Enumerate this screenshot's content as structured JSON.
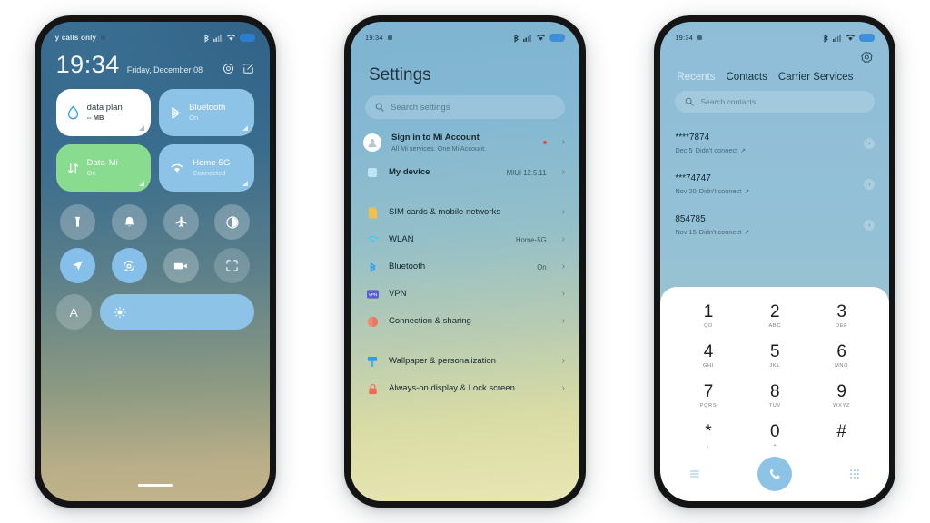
{
  "colors": {
    "accent_blue": "#8ec3e8",
    "tile_green": "#89dc8f",
    "notify_red": "#e8443a",
    "battery_blue": "#2b7fd0",
    "sim_yellow": "#f2c14b",
    "wlan_cyan": "#4dc8ef",
    "bluetooth_blue": "#2e9cf0",
    "vpn_purple": "#5b5bd6",
    "connection_orange": "#ef6a56",
    "wallpaper_blue": "#3a6e91",
    "lock_red": "#ef6a56"
  },
  "phone1": {
    "name": "Control center / lock screen",
    "statusbar": {
      "carrier": "y calls only",
      "icons": [
        "bluetooth-icon",
        "signal-icon",
        "wifi-icon",
        "battery-icon"
      ]
    },
    "clock": "19:34",
    "date": "Friday, December 08",
    "header_icons": [
      "settings-gear-icon",
      "edit-icon"
    ],
    "tiles": [
      {
        "title": "data plan",
        "sub": "-- MB",
        "icon": "water-drop-icon",
        "style": "white"
      },
      {
        "title": "Bluetooth",
        "sub": "On",
        "icon": "bluetooth-icon",
        "style": "blue"
      },
      {
        "title": "Data",
        "title2": "Mi",
        "sub": "On",
        "icon": "data-transfer-icon",
        "style": "green"
      },
      {
        "title": "Home-5G",
        "sub": "Connected",
        "icon": "wifi-icon",
        "style": "blue"
      }
    ],
    "toggles": [
      {
        "name": "flashlight-icon",
        "state": "off"
      },
      {
        "name": "ringtone-bell-icon",
        "state": "off"
      },
      {
        "name": "airplane-mode-icon",
        "state": "off"
      },
      {
        "name": "dark-mode-icon",
        "state": "off"
      },
      {
        "name": "location-icon",
        "state": "on"
      },
      {
        "name": "auto-rotate-icon",
        "state": "on"
      },
      {
        "name": "screen-recorder-icon",
        "state": "off"
      },
      {
        "name": "screenshot-icon",
        "state": "dim"
      }
    ],
    "font_size_label": "A",
    "brightness_icon": "sun-icon"
  },
  "phone2": {
    "name": "Settings",
    "statusbar": {
      "time": "19:34"
    },
    "title": "Settings",
    "search_placeholder": "Search settings",
    "rows": [
      {
        "label": "Sign in to Mi Account",
        "sub": "All Mi services. One Mi Account.",
        "value": "",
        "icon": "avatar-icon",
        "badge": true
      },
      {
        "label": "My device",
        "sub": "",
        "value": "MIUI 12.5.11",
        "icon": "device-icon",
        "badge": false
      },
      {
        "gap": true
      },
      {
        "label": "SIM cards & mobile networks",
        "sub": "",
        "value": "",
        "icon": "sim-card-icon",
        "badge": false
      },
      {
        "label": "WLAN",
        "sub": "",
        "value": "Home-5G",
        "icon": "wifi-icon",
        "badge": false
      },
      {
        "label": "Bluetooth",
        "sub": "",
        "value": "On",
        "icon": "bluetooth-icon",
        "badge": false
      },
      {
        "label": "VPN",
        "sub": "",
        "value": "",
        "icon": "vpn-icon",
        "badge": false
      },
      {
        "label": "Connection & sharing",
        "sub": "",
        "value": "",
        "icon": "connection-sharing-icon",
        "badge": false
      },
      {
        "gap": true
      },
      {
        "label": "Wallpaper & personalization",
        "sub": "",
        "value": "",
        "icon": "wallpaper-icon",
        "badge": false
      },
      {
        "label": "Always-on display & Lock screen",
        "sub": "",
        "value": "",
        "icon": "lock-icon",
        "badge": false
      }
    ]
  },
  "phone3": {
    "name": "Phone dialer",
    "statusbar": {
      "time": "19:34"
    },
    "gear_icon": "settings-gear-icon",
    "tabs": [
      {
        "label": "Recents",
        "active": true
      },
      {
        "label": "Contacts",
        "active": false
      },
      {
        "label": "Carrier Services",
        "active": false
      }
    ],
    "search_placeholder": "Search contacts",
    "calls": [
      {
        "number": "****7874",
        "date": "Dec 5",
        "status": "Didn't connect"
      },
      {
        "number": "***74747",
        "date": "Nov 20",
        "status": "Didn't connect"
      },
      {
        "number": "854785",
        "date": "Nov 15",
        "status": "Didn't connect"
      }
    ],
    "keypad": [
      {
        "digit": "1",
        "letters": "QD"
      },
      {
        "digit": "2",
        "letters": "ABC"
      },
      {
        "digit": "3",
        "letters": "DEF"
      },
      {
        "digit": "4",
        "letters": "GHI"
      },
      {
        "digit": "5",
        "letters": "JKL"
      },
      {
        "digit": "6",
        "letters": "MNO"
      },
      {
        "digit": "7",
        "letters": "PQRS"
      },
      {
        "digit": "8",
        "letters": "TUV"
      },
      {
        "digit": "9",
        "letters": "WXYZ"
      },
      {
        "digit": "*",
        "letters": ","
      },
      {
        "digit": "0",
        "letters": "+"
      },
      {
        "digit": "#",
        "letters": ""
      }
    ],
    "bottom": {
      "left_icon": "call-log-list-icon",
      "call_icon": "phone-call-icon",
      "right_icon": "keypad-icon"
    }
  }
}
